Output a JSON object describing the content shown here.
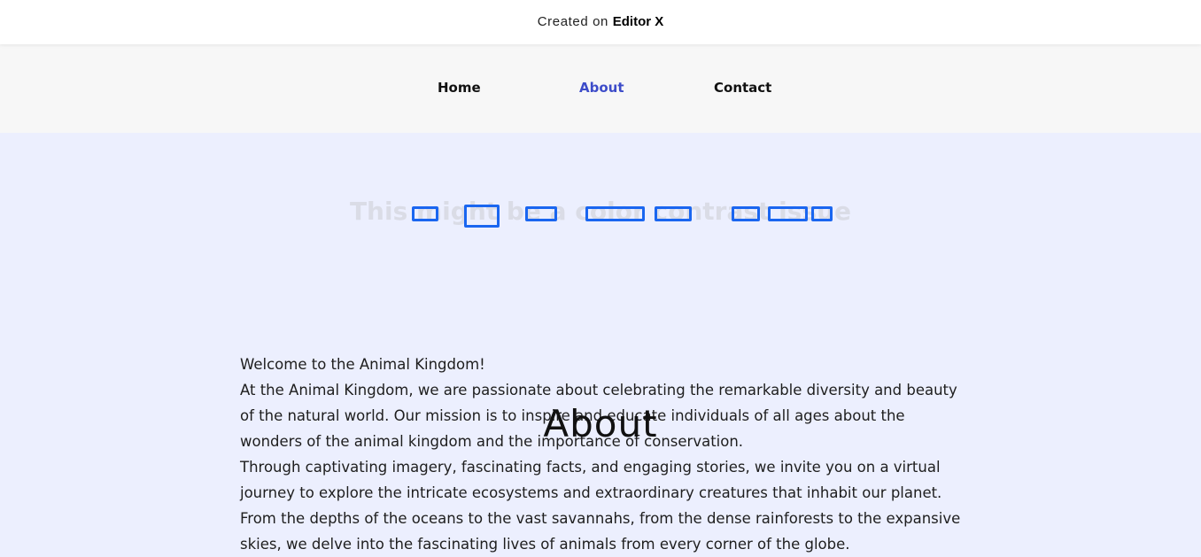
{
  "banner": {
    "prefix": "Created on ",
    "brand": "Editor X"
  },
  "nav": {
    "items": [
      {
        "label": "Home",
        "active": false
      },
      {
        "label": "About",
        "active": true
      },
      {
        "label": "Contact",
        "active": false
      }
    ]
  },
  "hero": {
    "contrast_text": "This might be a color contrast issue"
  },
  "about": {
    "heading": "About",
    "paragraphs": [
      "Welcome to the Animal Kingdom!",
      "At the Animal Kingdom, we are passionate about celebrating the remarkable diversity and beauty of the natural world. Our mission is to inspire and educate individuals of all ages about the wonders of the animal kingdom and the importance of conservation.",
      "Through captivating imagery, fascinating facts, and engaging stories, we invite you on a virtual journey to explore the intricate ecosystems and extraordinary creatures that inhabit our planet. From the depths of the oceans to the vast savannahs, from the dense rainforests to the expansive skies, we delve into the fascinating lives of animals from every corner of the globe."
    ]
  },
  "colors": {
    "nav_active": "#3D4CC9",
    "page_background": "#ECEFFE",
    "header_background": "#F7F7F7",
    "highlight_box": "#1A66F0",
    "low_contrast_text": "#DADCE6"
  }
}
